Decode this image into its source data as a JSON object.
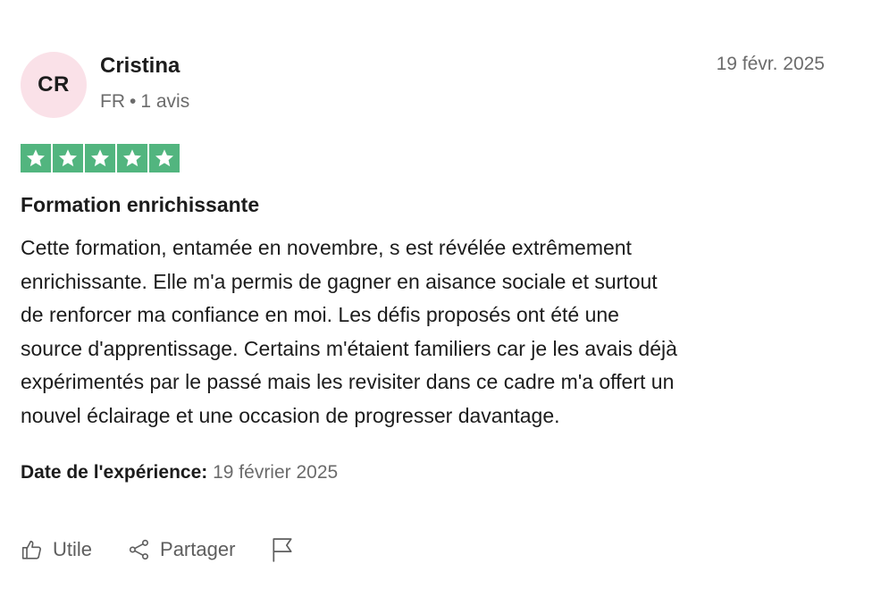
{
  "review": {
    "avatar_initials": "CR",
    "author_name": "Cristina",
    "author_country": "FR",
    "author_reviews": "1 avis",
    "date": "19 févr. 2025",
    "rating": 5,
    "rating_max": 5,
    "title": "Formation enrichissante",
    "body_lines": [
      "Cette formation, entamée en novembre, s est révélée extrêmement",
      "enrichissante. Elle m'a permis de gagner en aisance sociale et surtout",
      "de renforcer ma confiance en moi. Les défis proposés ont été une",
      "source d'apprentissage. Certains m'étaient familiers car je les avais déjà",
      "expérimentés par le passé mais les revisiter dans ce cadre m'a offert un",
      "nouvel éclairage et une occasion de progresser davantage."
    ],
    "experience_label": "Date de l'expérience:",
    "experience_date": "19 février 2025"
  },
  "actions": {
    "useful_label": "Utile",
    "share_label": "Partager",
    "useful_icon": "thumbs-up-icon",
    "share_icon": "share-icon",
    "report_icon": "flag-icon"
  },
  "colors": {
    "star_green": "#52b57f",
    "avatar_bg": "#fae1e8",
    "text_primary": "#1c1c1c",
    "text_secondary": "#6b6b6b"
  }
}
